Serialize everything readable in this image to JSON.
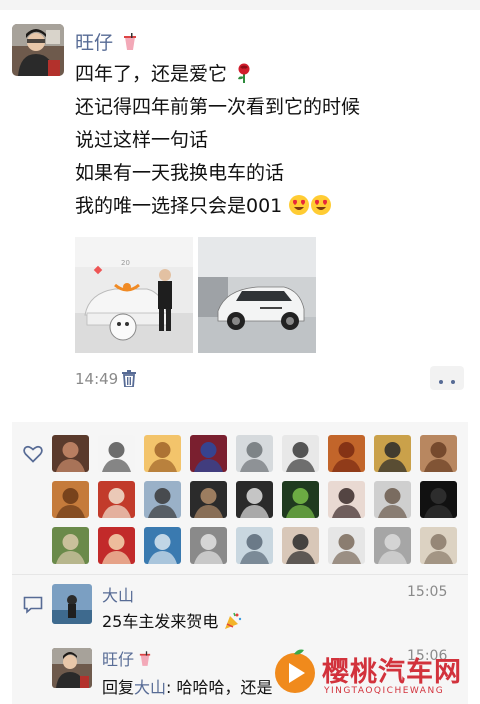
{
  "post": {
    "author": "旺仔",
    "lines": [
      "四年了，还是爱它",
      "还记得四年前第一次看到它的时候",
      "说过这样一句话",
      "如果有一天我换电车的话",
      "我的唯一选择只会是001"
    ],
    "time": "14:49"
  },
  "photos": {
    "photo1_plate": "20"
  },
  "comments": [
    {
      "author": "大山",
      "time": "15:05",
      "text": "25车主发来贺电"
    },
    {
      "author": "旺仔",
      "time": "15:06",
      "reply_prefix": "回复",
      "reply_to": "大山",
      "text": ": 哈哈哈，还是"
    }
  ],
  "watermark": {
    "title": "樱桃汽车网",
    "subtitle": "YINGTAOQICHEWANG"
  },
  "colors": {
    "link": "#576b95",
    "time": "#8a8a8a",
    "likes_bg": "#f6f6f6",
    "watermark": "#d2323c"
  },
  "icons": [
    "trash-icon",
    "more-icon",
    "heart-icon",
    "comment-icon",
    "rose-icon",
    "heart-eyes-emoji",
    "party-popper-emoji"
  ]
}
